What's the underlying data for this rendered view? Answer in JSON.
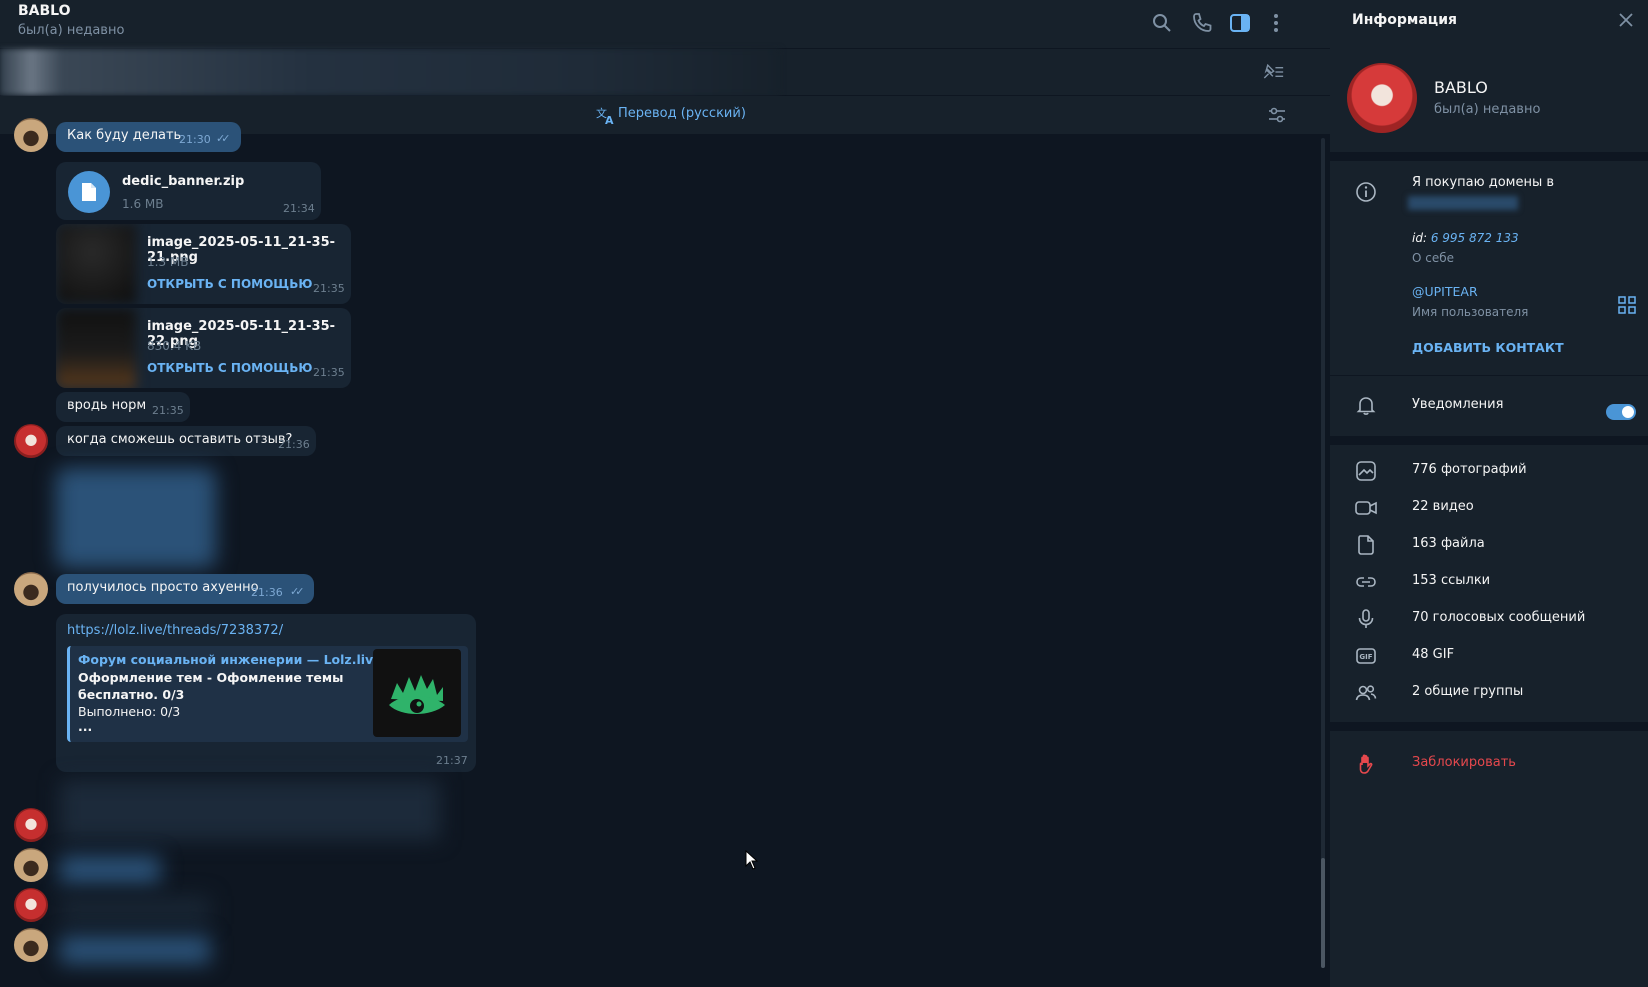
{
  "chat": {
    "title": "BABLO",
    "status": "был(а) недавно",
    "translate_label": "Перевод (русский)",
    "messages": {
      "m1_text": "Как буду делать",
      "m1_time": "21:30",
      "file_name": "dedic_banner.zip",
      "file_size": "1.6 MB",
      "file_time": "21:34",
      "img1_name": "image_2025-05-11_21-35-21.png",
      "img1_size": "1.3 MB",
      "img1_action": "ОТКРЫТЬ С ПОМОЩЬЮ",
      "img1_time": "21:35",
      "img2_name": "image_2025-05-11_21-35-22.png",
      "img2_size": "830.4 KB",
      "img2_action": "ОТКРЫТЬ С ПОМОЩЬЮ",
      "img2_time": "21:35",
      "m2_text": "вродь норм",
      "m2_time": "21:35",
      "m3_text": "когда сможешь оставить отзыв?",
      "m3_time": "21:36",
      "m4_text": "получилось просто ахуенно",
      "m4_time": "21:36",
      "link_url": "https://lolz.live/threads/7238372/",
      "link_site_title": "Форум социальной инженерии — Lolz.live...",
      "link_desc1": "Оформление тем - Офомление темы",
      "link_desc2": "бесплатно. 0/3",
      "link_desc3": "Выполнено: 0/3",
      "link_desc4": "...",
      "link_time": "21:37"
    }
  },
  "info": {
    "panel_title": "Информация",
    "name": "BABLO",
    "status": "был(а) недавно",
    "bio": "Я покупаю домены в",
    "id_label": "id:",
    "id_value": "6 995 872 133",
    "bio_caption": "О себе",
    "username": "@UPITEAR",
    "username_caption": "Имя пользователя",
    "add_contact": "ДОБАВИТЬ КОНТАКТ",
    "notifications": "Уведомления",
    "notifications_on": true,
    "media": {
      "photos": "776 фотографий",
      "videos": "22 видео",
      "files": "163 файла",
      "links": "153 ссылки",
      "voice": "70 голосовых сообщений",
      "gif": "48 GIF",
      "groups": "2 общие группы"
    },
    "block": "Заблокировать"
  },
  "colors": {
    "accent": "#6ab3f3",
    "outgoing_bubble": "#2b5278",
    "incoming_bubble": "#182533",
    "danger": "#e5484d",
    "background": "#0e1621",
    "panel": "#17212b"
  },
  "icons": [
    "search-icon",
    "phone-icon",
    "sidebar-toggle-icon",
    "more-vert-icon",
    "pin-list-icon",
    "translate-icon",
    "translate-settings-icon",
    "close-icon",
    "info-icon",
    "qr-icon",
    "bell-icon",
    "photo-icon",
    "video-icon",
    "file-icon",
    "link-icon",
    "mic-icon",
    "gif-icon",
    "group-icon",
    "hand-icon"
  ]
}
